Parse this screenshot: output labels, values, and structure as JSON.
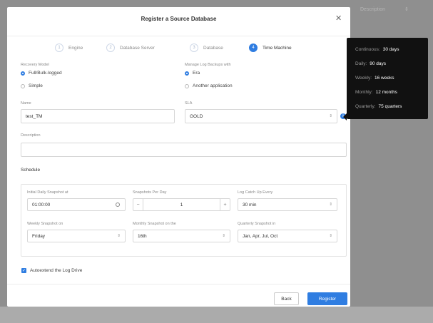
{
  "background": {
    "column_header": "Description"
  },
  "modal": {
    "title": "Register a Source Database",
    "steps": [
      {
        "num": "1",
        "label": "Engine"
      },
      {
        "num": "2",
        "label": "Database Server"
      },
      {
        "num": "3",
        "label": "Database"
      },
      {
        "num": "4",
        "label": "Time Machine"
      }
    ],
    "recovery_model": {
      "label": "Recovery Model",
      "options": [
        "Full/Bulk-logged",
        "Simple"
      ],
      "selected": "Full/Bulk-logged"
    },
    "log_backups": {
      "label": "Manage Log Backups with",
      "options": [
        "Era",
        "Another application"
      ],
      "selected": "Era"
    },
    "name": {
      "label": "Name",
      "value": "test_TM"
    },
    "sla": {
      "label": "SLA",
      "value": "GOLD",
      "info_icon": "i"
    },
    "description": {
      "label": "Description",
      "value": ""
    },
    "schedule": {
      "title": "Schedule",
      "initial_snapshot": {
        "label": "Initial Daily Snapshot at",
        "value": "01:00:00"
      },
      "snapshots_per_day": {
        "label": "Snapshots Per Day",
        "value": "1",
        "minus": "−",
        "plus": "+"
      },
      "log_catchup": {
        "label": "Log Catch Up Every",
        "value": "30 min"
      },
      "weekly_snapshot": {
        "label": "Weekly Snapshot on",
        "value": "Friday"
      },
      "monthly_snapshot": {
        "label": "Monthly Snapshot on the",
        "value": "16th"
      },
      "quarterly_snapshot": {
        "label": "Quarterly Snapshot in",
        "value": "Jan, Apr, Jul, Oct"
      }
    },
    "autoextend": {
      "label": "Autoextend the Log Drive",
      "checked": true
    },
    "buttons": {
      "back": "Back",
      "register": "Register"
    }
  },
  "sla_tooltip": [
    {
      "key": "Continuous:",
      "value": "30 days"
    },
    {
      "key": "Daily:",
      "value": "90 days"
    },
    {
      "key": "Weekly:",
      "value": "16 weeks"
    },
    {
      "key": "Monthly:",
      "value": "12 months"
    },
    {
      "key": "Quarterly:",
      "value": "75 quarters"
    }
  ],
  "colors": {
    "accent": "#2f7de1",
    "tooltip_bg": "#111111",
    "backdrop": "#8f8f8f"
  },
  "icons": {
    "close": "close-icon",
    "clock": "clock-icon",
    "chevron": "chevron-updown-icon",
    "info": "info-icon",
    "check": "checkmark-icon"
  }
}
